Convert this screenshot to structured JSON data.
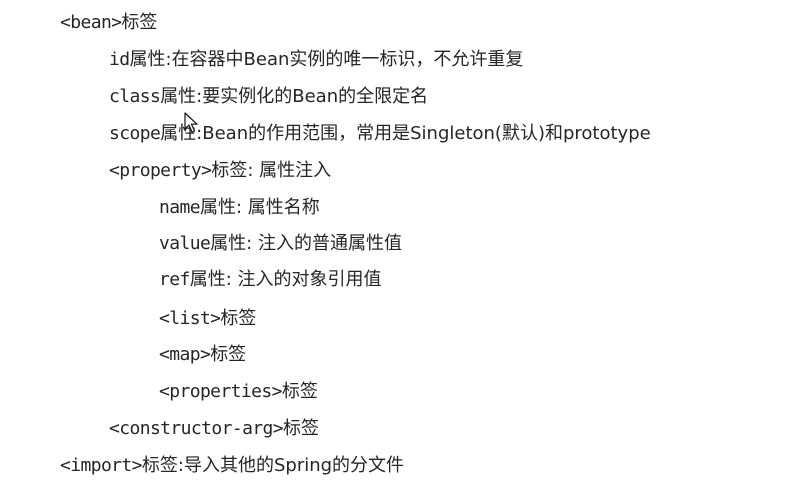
{
  "lines": [
    {
      "code": "<bean>",
      "text": "标签"
    },
    {
      "code": "id",
      "text": "属性:在容器中Bean实例的唯一标识，不允许重复"
    },
    {
      "code": "class",
      "text": "属性:要实例化的Bean的全限定名"
    },
    {
      "code": "scope",
      "text": "属性:Bean的作用范围，常用是Singleton(默认)和prototype"
    },
    {
      "code": "<property>",
      "text": "标签: 属性注入"
    },
    {
      "code": "name",
      "text": "属性: 属性名称"
    },
    {
      "code": "value",
      "text": "属性: 注入的普通属性值"
    },
    {
      "code": "ref",
      "text": "属性: 注入的对象引用值"
    },
    {
      "code": "<list>",
      "text": "标签"
    },
    {
      "code": "<map>",
      "text": "标签"
    },
    {
      "code": "<properties>",
      "text": "标签"
    },
    {
      "code": "<constructor-arg>",
      "text": "标签"
    },
    {
      "code": "<import>",
      "text": "标签:导入其他的Spring的分文件"
    }
  ],
  "icons": {
    "cursor": "mouse-pointer-icon"
  }
}
